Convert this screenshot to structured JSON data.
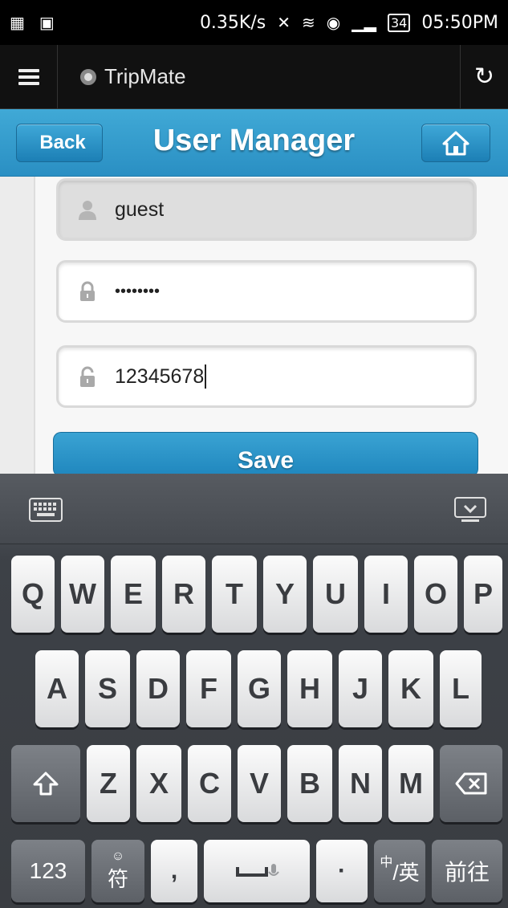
{
  "status_bar": {
    "speed": "0.35K/s",
    "battery": "34",
    "time": "05:50PM"
  },
  "app": {
    "title": "TripMate"
  },
  "header": {
    "back_label": "Back",
    "title": "User Manager"
  },
  "form": {
    "username": "guest",
    "password_mask": "••••••••",
    "new_password": "12345678",
    "save_label": "Save"
  },
  "keyboard": {
    "row1": [
      "Q",
      "W",
      "E",
      "R",
      "T",
      "Y",
      "U",
      "I",
      "O",
      "P"
    ],
    "row2": [
      "A",
      "S",
      "D",
      "F",
      "G",
      "H",
      "J",
      "K",
      "L"
    ],
    "row3": [
      "Z",
      "X",
      "C",
      "V",
      "B",
      "N",
      "M"
    ],
    "numbers_label": "123",
    "symbols_label": "符",
    "comma_label": ",",
    "period_label": "·",
    "lang_label_small": "中",
    "lang_label": "/英",
    "go_label": "前往"
  },
  "colors": {
    "header_blue": "#2a8fc3",
    "keyboard_bg": "#3a3d42"
  }
}
